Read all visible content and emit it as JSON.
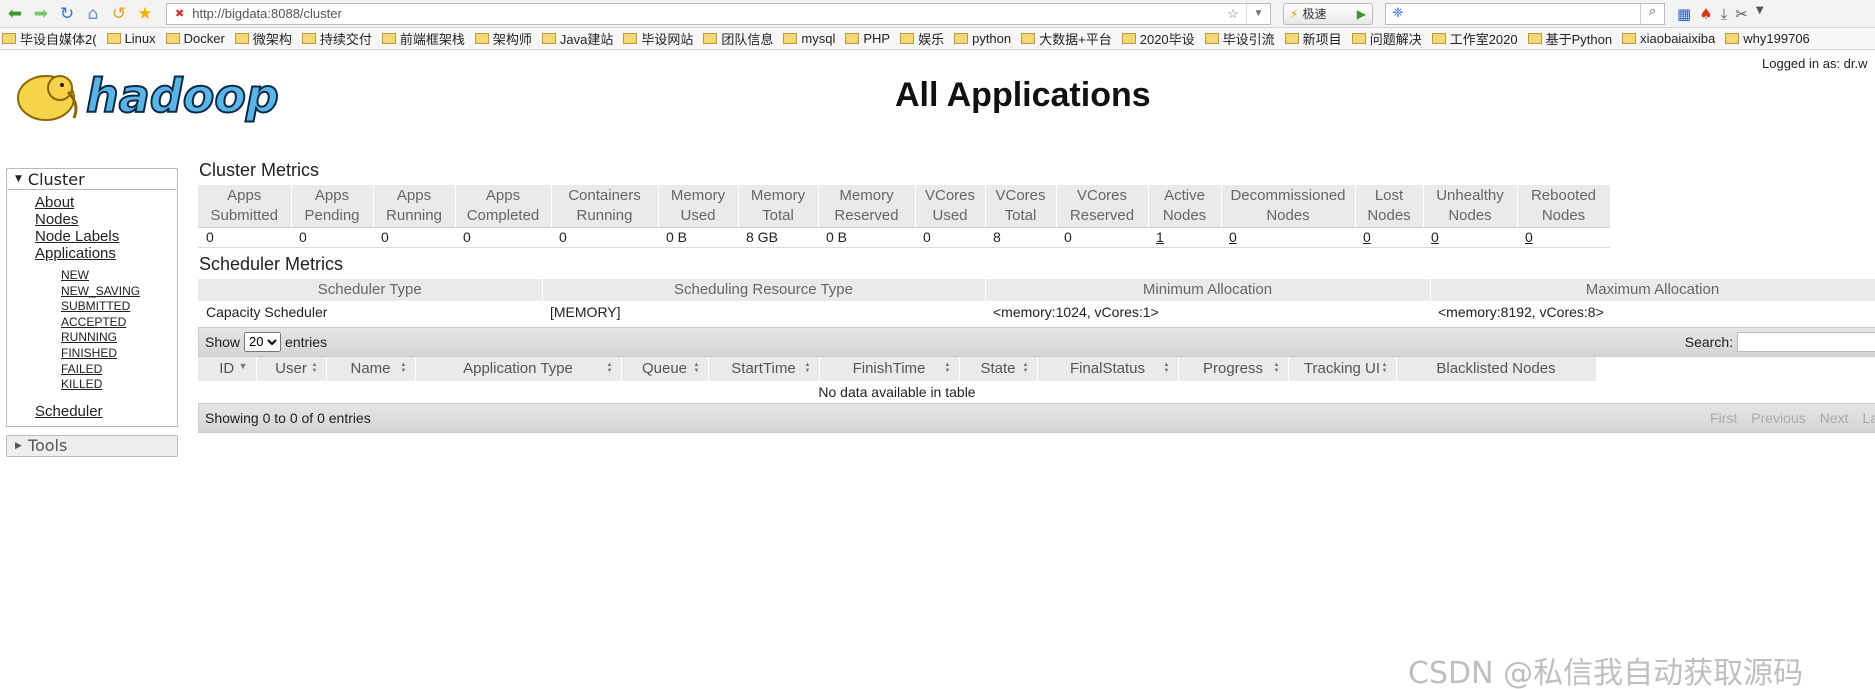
{
  "browser": {
    "url": "http://bigdata:8088/cluster",
    "speed_label": "极速",
    "search_value": "",
    "bookmarks": [
      "毕设自媒体2(",
      "Linux",
      "Docker",
      "微架构",
      "持续交付",
      "前端框架栈",
      "架构师",
      "Java建站",
      "毕设网站",
      "团队信息",
      "mysql",
      "PHP",
      "娱乐",
      "python",
      "大数据+平台",
      "2020毕设",
      "毕设引流",
      "新项目",
      "问题解决",
      "工作室2020",
      "基于Python",
      "xiaobaiaixiba",
      "why199706"
    ]
  },
  "header": {
    "logged_in": "Logged in as: dr.w",
    "title": "All Applications",
    "logo_text": "hadoop"
  },
  "nav": {
    "cluster_label": "Cluster",
    "links": [
      "About",
      "Nodes",
      "Node Labels",
      "Applications"
    ],
    "app_states": [
      "NEW",
      "NEW_SAVING",
      "SUBMITTED",
      "ACCEPTED",
      "RUNNING",
      "FINISHED",
      "FAILED",
      "KILLED"
    ],
    "scheduler": "Scheduler",
    "tools_label": "Tools"
  },
  "cluster_metrics": {
    "title": "Cluster Metrics",
    "headers": [
      [
        "Apps",
        "Submitted"
      ],
      [
        "Apps",
        "Pending"
      ],
      [
        "Apps",
        "Running"
      ],
      [
        "Apps",
        "Completed"
      ],
      [
        "Containers",
        "Running"
      ],
      [
        "Memory",
        "Used"
      ],
      [
        "Memory",
        "Total"
      ],
      [
        "Memory",
        "Reserved"
      ],
      [
        "VCores",
        "Used"
      ],
      [
        "VCores",
        "Total"
      ],
      [
        "VCores",
        "Reserved"
      ],
      [
        "Active",
        "Nodes"
      ],
      [
        "Decommissioned",
        "Nodes"
      ],
      [
        "Lost",
        "Nodes"
      ],
      [
        "Unhealthy",
        "Nodes"
      ],
      [
        "Rebooted",
        "Nodes"
      ]
    ],
    "values": [
      "0",
      "0",
      "0",
      "0",
      "0",
      "0 B",
      "8 GB",
      "0 B",
      "0",
      "8",
      "0",
      "1",
      "0",
      "0",
      "0",
      "0"
    ]
  },
  "scheduler_metrics": {
    "title": "Scheduler Metrics",
    "headers": [
      "Scheduler Type",
      "Scheduling Resource Type",
      "Minimum Allocation",
      "Maximum Allocation"
    ],
    "values": [
      "Capacity Scheduler",
      "[MEMORY]",
      "<memory:1024, vCores:1>",
      "<memory:8192, vCores:8>"
    ]
  },
  "apps_table": {
    "show_label": "Show",
    "page_size": "20",
    "entries_label": "entries",
    "search_label": "Search:",
    "columns": [
      "ID",
      "User",
      "Name",
      "Application Type",
      "Queue",
      "StartTime",
      "FinishTime",
      "State",
      "FinalStatus",
      "Progress",
      "Tracking UI",
      "Blacklisted Nodes"
    ],
    "empty_message": "No data available in table",
    "showing": "Showing 0 to 0 of 0 entries",
    "pager": [
      "First",
      "Previous",
      "Next",
      "Last"
    ]
  },
  "watermark": "CSDN @私信我自动获取源码"
}
